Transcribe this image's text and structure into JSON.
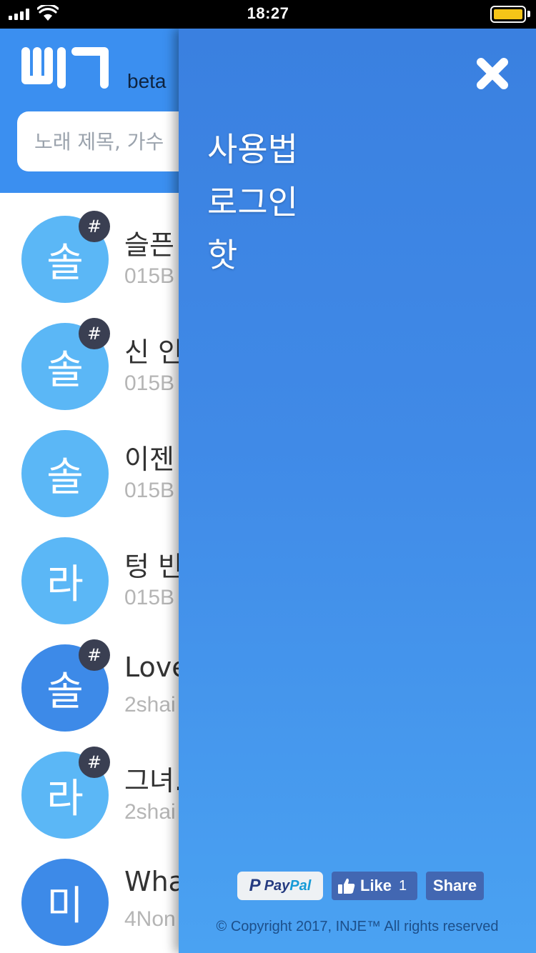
{
  "status_bar": {
    "time": "18:27",
    "battery_color": "#f5c518"
  },
  "header": {
    "logo_text": "뭐지",
    "beta_label": "beta",
    "search_placeholder": "노래 제목, 가수"
  },
  "songs": [
    {
      "avatar": "솔",
      "badge": "#",
      "title": "슬픈",
      "artist": "015B"
    },
    {
      "avatar": "솔",
      "badge": "#",
      "title": "신 인",
      "artist": "015B"
    },
    {
      "avatar": "솔",
      "badge": "",
      "title": "이젠",
      "artist": "015B"
    },
    {
      "avatar": "라",
      "badge": "",
      "title": "텅 빈",
      "artist": "015B"
    },
    {
      "avatar": "솔",
      "badge": "#",
      "title": "Love",
      "artist": "2shai"
    },
    {
      "avatar": "라",
      "badge": "#",
      "title": "그녀.",
      "artist": "2shai"
    },
    {
      "avatar": "미",
      "badge": "",
      "title": "Wha",
      "artist": "4Non"
    }
  ],
  "drawer": {
    "menu": [
      "사용법",
      "로그인",
      "핫"
    ],
    "paypal": {
      "glyph": "P",
      "text_a": "Pay",
      "text_b": "Pal"
    },
    "fb_like": {
      "label": "Like",
      "count": "1"
    },
    "fb_share": "Share",
    "copyright": "© Copyright 2017, INJE™ All rights reserved"
  },
  "colors": {
    "header_bg": "#3b8ff0",
    "avatar_light": "#5bb7f6",
    "avatar_deep": "#3d8ae8",
    "badge_bg": "#3a3f52",
    "drawer_top": "#3a80e0",
    "drawer_bottom": "#4aa2f2",
    "facebook_blue": "#4267b2"
  },
  "icons": {
    "close": "close-icon",
    "search": "search-field",
    "like": "thumbs-up-icon"
  }
}
